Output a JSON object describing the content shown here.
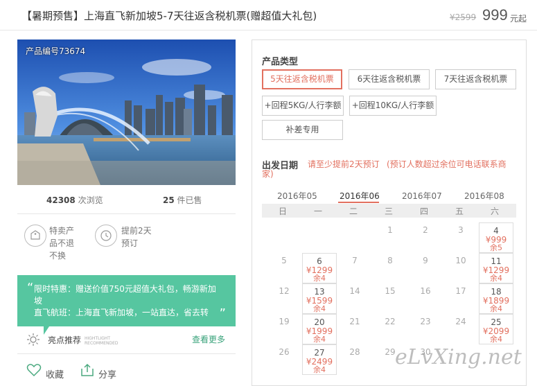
{
  "header": {
    "title": "【暑期预售】上海直飞新加坡5-7天往返含税机票(赠超值大礼包)",
    "old_price": "¥2599",
    "price": "999",
    "price_unit": "元起"
  },
  "hero": {
    "product_no": "产品编号73674"
  },
  "stats": {
    "views_count": "42308",
    "views_label": "次浏览",
    "sold_count": "25",
    "sold_label": "件已售"
  },
  "features": [
    {
      "icon": "tag-icon",
      "lines": [
        "特卖产",
        "品不退",
        "不换"
      ]
    },
    {
      "icon": "clock-icon",
      "lines": [
        "提前2天",
        "预订"
      ]
    }
  ],
  "promo": {
    "line1": "限时特惠：赠送价值750元超值大礼包，畅游新加",
    "line2": "坡",
    "line3": "直飞航班：上海直飞新加坡，一站直达，省去转"
  },
  "recommend": {
    "label": "亮点推荐",
    "en1": "HIGHTLIGHT",
    "en2": "RECOMMENDED",
    "more": "查看更多"
  },
  "actions": {
    "fav": "收藏",
    "share": "分享"
  },
  "product_type": {
    "label": "产品类型",
    "options": [
      "5天往返含税机票",
      "6天往返含税机票",
      "7天往返含税机票",
      "+回程5KG/人行李额",
      "+回程10KG/人行李额",
      "补差专用"
    ],
    "selected": "5天往返含税机票"
  },
  "departure": {
    "label": "出发日期",
    "note1": "请至少提前2天预订",
    "note2": "(预订人数超过余位可电话联系商",
    "note3": "家)",
    "months": [
      "2016年05",
      "2016年06",
      "2016年07",
      "2016年08"
    ],
    "selected_month": "2016年06",
    "weekdays": [
      "日",
      "一",
      "二",
      "三",
      "四",
      "五",
      "六"
    ],
    "days": [
      {
        "d": "1"
      },
      {
        "d": "2"
      },
      {
        "d": "3"
      },
      {
        "d": "4",
        "price": "¥999",
        "remain": "余5"
      },
      {
        "d": "5"
      },
      {
        "d": "6",
        "price": "¥1299",
        "remain": "余4"
      },
      {
        "d": "7"
      },
      {
        "d": "8"
      },
      {
        "d": "9"
      },
      {
        "d": "10"
      },
      {
        "d": "11",
        "price": "¥1299",
        "remain": "余4"
      },
      {
        "d": "12"
      },
      {
        "d": "13",
        "price": "¥1599",
        "remain": "余4"
      },
      {
        "d": "14"
      },
      {
        "d": "15"
      },
      {
        "d": "16"
      },
      {
        "d": "17"
      },
      {
        "d": "18",
        "price": "¥1899",
        "remain": "余4"
      },
      {
        "d": "19"
      },
      {
        "d": "20",
        "price": "¥1999",
        "remain": "余4"
      },
      {
        "d": "21"
      },
      {
        "d": "22"
      },
      {
        "d": "23"
      },
      {
        "d": "24"
      },
      {
        "d": "25",
        "price": "¥2099",
        "remain": "余4"
      },
      {
        "d": "26"
      },
      {
        "d": "27",
        "price": "¥2499",
        "remain": "余4"
      },
      {
        "d": "28"
      },
      {
        "d": "29"
      },
      {
        "d": "30"
      }
    ]
  },
  "watermark": "eLvXing.net",
  "colors": {
    "accent": "#e2705f",
    "promo_bg": "#56c6a0",
    "more_link": "#3aa37b"
  }
}
